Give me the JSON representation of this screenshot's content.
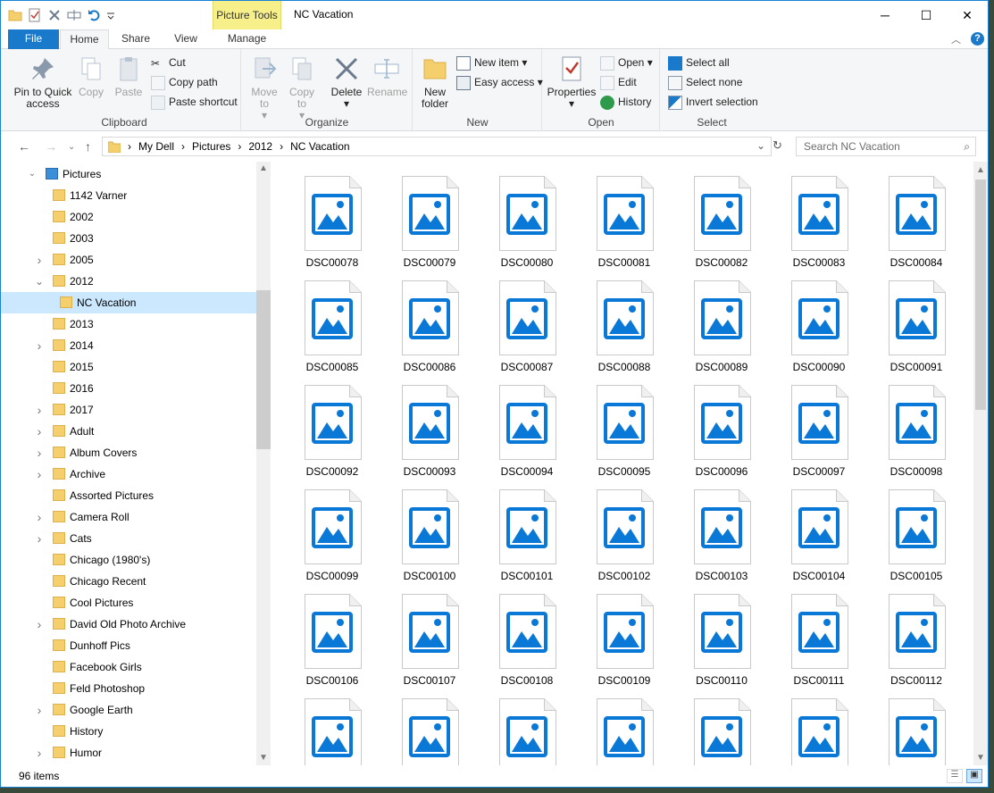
{
  "window": {
    "title": "NC Vacation",
    "context_tab": "Picture Tools"
  },
  "qat": {
    "icons": [
      "folder-icon",
      "properties-check-icon",
      "delete-x-icon",
      "rename-icon",
      "undo-icon",
      "dropdown-icon"
    ]
  },
  "window_controls": {
    "minimize": "─",
    "maximize": "☐",
    "close": "✕"
  },
  "tabs": {
    "file": "File",
    "home": "Home",
    "share": "Share",
    "view": "View",
    "manage": "Manage"
  },
  "ribbon": {
    "clipboard": {
      "label": "Clipboard",
      "pin": "Pin to Quick access",
      "copy": "Copy",
      "paste": "Paste",
      "cut": "Cut",
      "copy_path": "Copy path",
      "paste_shortcut": "Paste shortcut"
    },
    "organize": {
      "label": "Organize",
      "move_to": "Move to",
      "copy_to": "Copy to",
      "delete": "Delete",
      "rename": "Rename"
    },
    "new": {
      "label": "New",
      "new_folder": "New folder",
      "new_item": "New item",
      "easy_access": "Easy access"
    },
    "open": {
      "label": "Open",
      "properties": "Properties",
      "open": "Open",
      "edit": "Edit",
      "history": "History"
    },
    "select": {
      "label": "Select",
      "select_all": "Select all",
      "select_none": "Select none",
      "invert": "Invert selection"
    }
  },
  "address": {
    "crumbs": [
      "My Dell",
      "Pictures",
      "2012",
      "NC Vacation"
    ],
    "search_placeholder": "Search NC Vacation"
  },
  "tree": {
    "root": "Pictures",
    "items": [
      {
        "label": "1142 Varner",
        "expander": ""
      },
      {
        "label": "2002",
        "expander": ""
      },
      {
        "label": "2003",
        "expander": ""
      },
      {
        "label": "2005",
        "expander": ">"
      },
      {
        "label": "2012",
        "expander": "v"
      },
      {
        "label": "NC Vacation",
        "expander": ""
      },
      {
        "label": "2013",
        "expander": ""
      },
      {
        "label": "2014",
        "expander": ">"
      },
      {
        "label": "2015",
        "expander": ""
      },
      {
        "label": "2016",
        "expander": ""
      },
      {
        "label": "2017",
        "expander": ">"
      },
      {
        "label": "Adult",
        "expander": ">"
      },
      {
        "label": "Album Covers",
        "expander": ">"
      },
      {
        "label": "Archive",
        "expander": ">"
      },
      {
        "label": "Assorted Pictures",
        "expander": ""
      },
      {
        "label": "Camera Roll",
        "expander": ">"
      },
      {
        "label": "Cats",
        "expander": ">"
      },
      {
        "label": "Chicago (1980's)",
        "expander": ""
      },
      {
        "label": "Chicago Recent",
        "expander": ""
      },
      {
        "label": "Cool Pictures",
        "expander": ""
      },
      {
        "label": "David Old Photo Archive",
        "expander": ">"
      },
      {
        "label": "Dunhoff Pics",
        "expander": ""
      },
      {
        "label": "Facebook Girls",
        "expander": ""
      },
      {
        "label": "Feld Photoshop",
        "expander": ""
      },
      {
        "label": "Google Earth",
        "expander": ">"
      },
      {
        "label": "History",
        "expander": ""
      },
      {
        "label": "Humor",
        "expander": ">"
      }
    ],
    "selected": "NC Vacation"
  },
  "files": [
    "DSC00078",
    "DSC00079",
    "DSC00080",
    "DSC00081",
    "DSC00082",
    "DSC00083",
    "DSC00084",
    "DSC00085",
    "DSC00086",
    "DSC00087",
    "DSC00088",
    "DSC00089",
    "DSC00090",
    "DSC00091",
    "DSC00092",
    "DSC00093",
    "DSC00094",
    "DSC00095",
    "DSC00096",
    "DSC00097",
    "DSC00098",
    "DSC00099",
    "DSC00100",
    "DSC00101",
    "DSC00102",
    "DSC00103",
    "DSC00104",
    "DSC00105",
    "DSC00106",
    "DSC00107",
    "DSC00108",
    "DSC00109",
    "DSC00110",
    "DSC00111",
    "DSC00112",
    "",
    "",
    "",
    "",
    "",
    "",
    ""
  ],
  "status": {
    "count": "96 items"
  },
  "colors": {
    "accent": "#1979ca",
    "selection": "#cce8ff",
    "image_icon": "#0a78d7",
    "folder": "#f4cf6b"
  }
}
